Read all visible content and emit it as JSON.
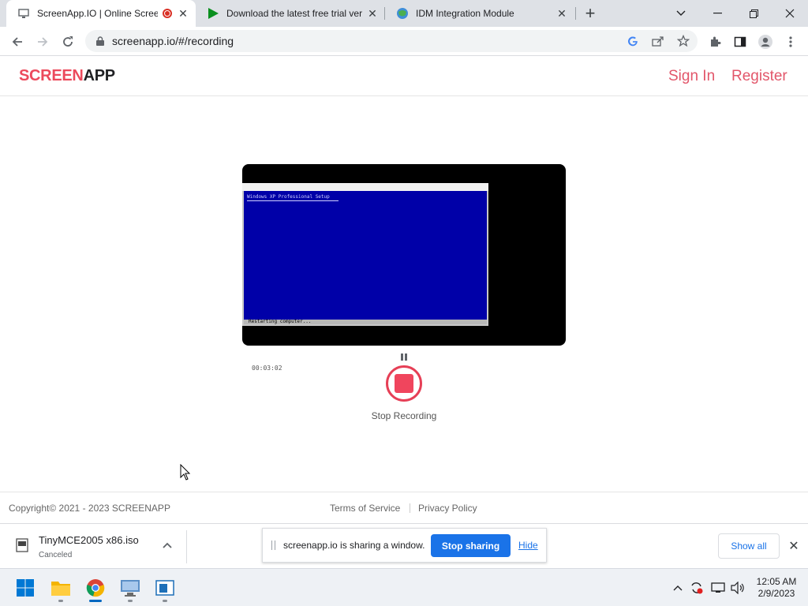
{
  "browser": {
    "tabs": [
      {
        "title": "ScreenApp.IO | Online Scree",
        "icon": "monitor-icon",
        "active": true
      },
      {
        "title": "Download the latest free trial ver",
        "icon": "play-icon",
        "active": false
      },
      {
        "title": "IDM Integration Module",
        "icon": "idm-globe-icon",
        "active": false
      }
    ],
    "url": "screenapp.io/#/recording"
  },
  "site": {
    "logo_part1": "SCREEN",
    "logo_part2": "APP",
    "sign_in": "Sign In",
    "register": "Register"
  },
  "recorder": {
    "preview_title": "Windows XP Professional Setup",
    "preview_status": "Restarting computer...",
    "timer": "00:03:02",
    "stop_label": "Stop Recording"
  },
  "footer": {
    "copyright": "Copyright©  2021 - 2023 SCREENAPP",
    "terms": "Terms of Service",
    "privacy": "Privacy Policy"
  },
  "downloads": {
    "file_name": "TinyMCE2005 x86.iso",
    "file_status": "Canceled",
    "share_text": "screenapp.io is sharing a window.",
    "stop_sharing": "Stop sharing",
    "hide": "Hide",
    "show_all": "Show all"
  },
  "taskbar": {
    "time": "12:05 AM",
    "date": "2/9/2023"
  },
  "colors": {
    "brand_red": "#ec4a5c",
    "chrome_blue": "#1a73e8",
    "xp_blue": "#0000a8"
  }
}
